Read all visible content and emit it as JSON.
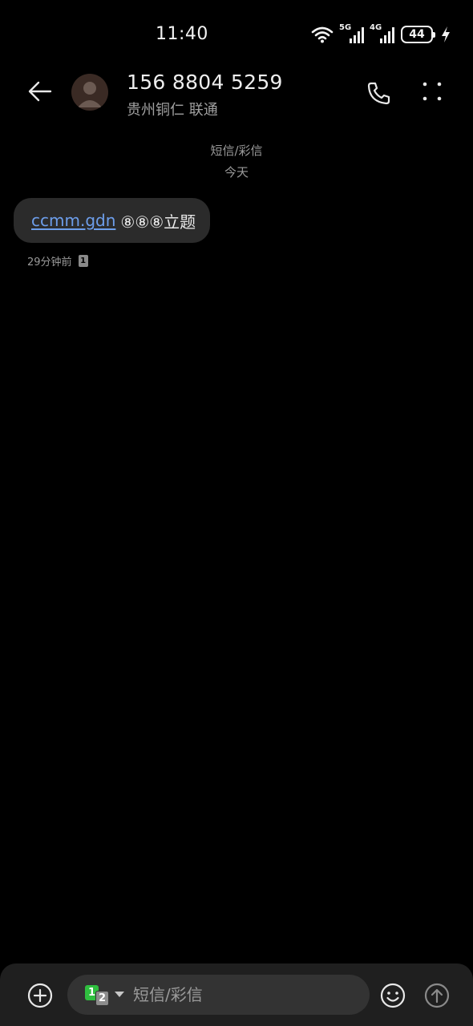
{
  "status_bar": {
    "time": "11:40",
    "network1": "5G",
    "network2": "4G",
    "battery": "44",
    "icons": [
      "wifi-icon",
      "signal-5g-icon",
      "signal-4g-icon",
      "battery-icon",
      "charging-icon"
    ]
  },
  "header": {
    "contact_number": "156 8804 5259",
    "contact_location": "贵州铜仁 联通",
    "icons": [
      "back-arrow-icon",
      "avatar-icon",
      "phone-icon",
      "more-vertical-icon"
    ]
  },
  "conversation": {
    "type_label": "短信/彩信",
    "date_label": "今天",
    "messages": [
      {
        "link": "ccmm.gdn",
        "text": "⑧⑧⑧立题",
        "time": "29分钟前",
        "sim": "1"
      }
    ]
  },
  "composer": {
    "placeholder": "短信/彩信",
    "sim_primary": "1",
    "sim_secondary": "2",
    "icons": [
      "add-icon",
      "sim-switch-icon",
      "emoji-icon",
      "send-icon"
    ]
  },
  "colors": {
    "background": "#000000",
    "bubble": "#2b2b2b",
    "link": "#6d9eeb",
    "sim1": "#2fbf3f",
    "composer": "#1f1f1f"
  }
}
